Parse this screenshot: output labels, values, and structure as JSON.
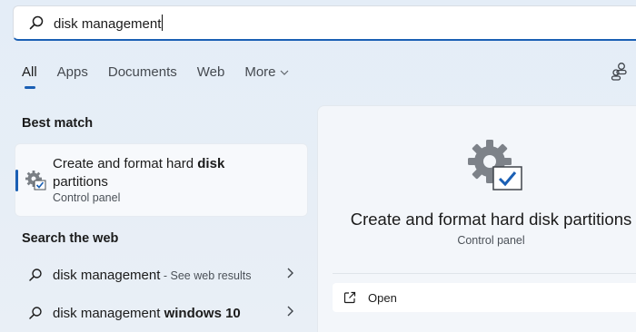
{
  "search": {
    "query": "disk management"
  },
  "tabs": [
    {
      "label": "All",
      "active": true
    },
    {
      "label": "Apps"
    },
    {
      "label": "Documents"
    },
    {
      "label": "Web"
    },
    {
      "label": "More",
      "chevron": "chevron-down-icon"
    }
  ],
  "best_match": {
    "heading": "Best match",
    "title_prefix": "Create and format hard ",
    "title_bold": "disk",
    "title_suffix": "partitions",
    "subtitle": "Control panel",
    "icon": "gear-check-icon"
  },
  "web": {
    "heading": "Search the web",
    "items": [
      {
        "query": "disk management",
        "suffix": " - See web results"
      },
      {
        "query": "disk management ",
        "bold": "windows 10"
      }
    ]
  },
  "detail": {
    "title": "Create and format hard disk partitions",
    "subtitle": "Control panel",
    "open_label": "Open",
    "icon": "gear-check-icon"
  },
  "colors": {
    "accent": "#1a5fb4",
    "background": "#e4edf7"
  }
}
